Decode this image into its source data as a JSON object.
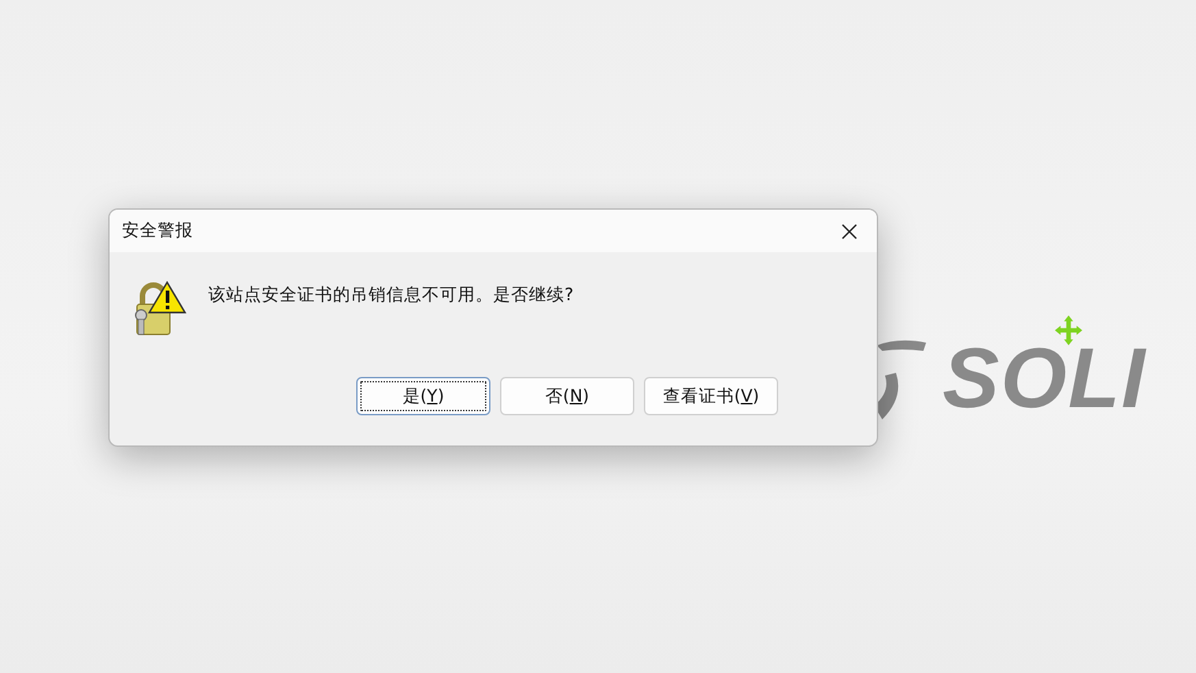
{
  "background": {
    "logo_text": "SOLI"
  },
  "dialog": {
    "title": "安全警报",
    "message": "该站点安全证书的吊销信息不可用。是否继续?",
    "buttons": [
      {
        "label_before": "是(",
        "accesskey": "Y",
        "label_after": ")",
        "focused": true
      },
      {
        "label_before": "否(",
        "accesskey": "N",
        "label_after": ")",
        "focused": false
      },
      {
        "label_before": "查看证书(",
        "accesskey": "V",
        "label_after": ")",
        "focused": false
      }
    ]
  }
}
